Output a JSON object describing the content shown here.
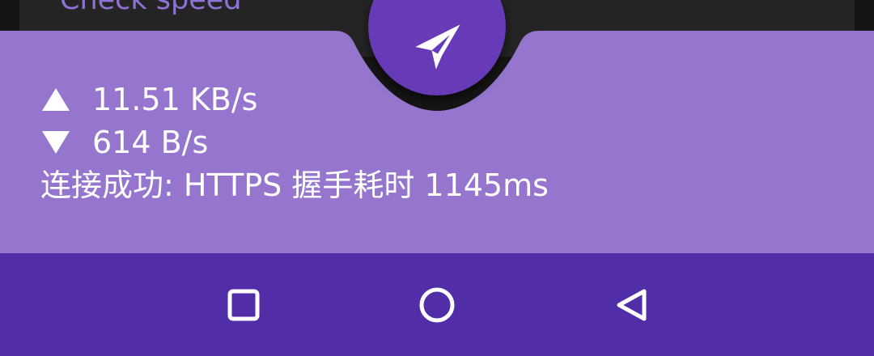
{
  "background_card": {
    "text": "Check speed"
  },
  "connection_panel": {
    "upload_speed": "11.51 KB/s",
    "download_speed": "614 B/s",
    "status_text": "连接成功: HTTPS 握手耗时 1145ms"
  },
  "fab": {
    "icon": "paper-plane-icon"
  },
  "nav_bar": {
    "recent_icon": "square-icon",
    "home_icon": "circle-icon",
    "back_icon": "triangle-back-icon"
  },
  "colors": {
    "panel": "#9575CD",
    "fab": "#673AB7",
    "nav_bar": "#512DA8",
    "background": "#151515",
    "card": "#242424"
  }
}
